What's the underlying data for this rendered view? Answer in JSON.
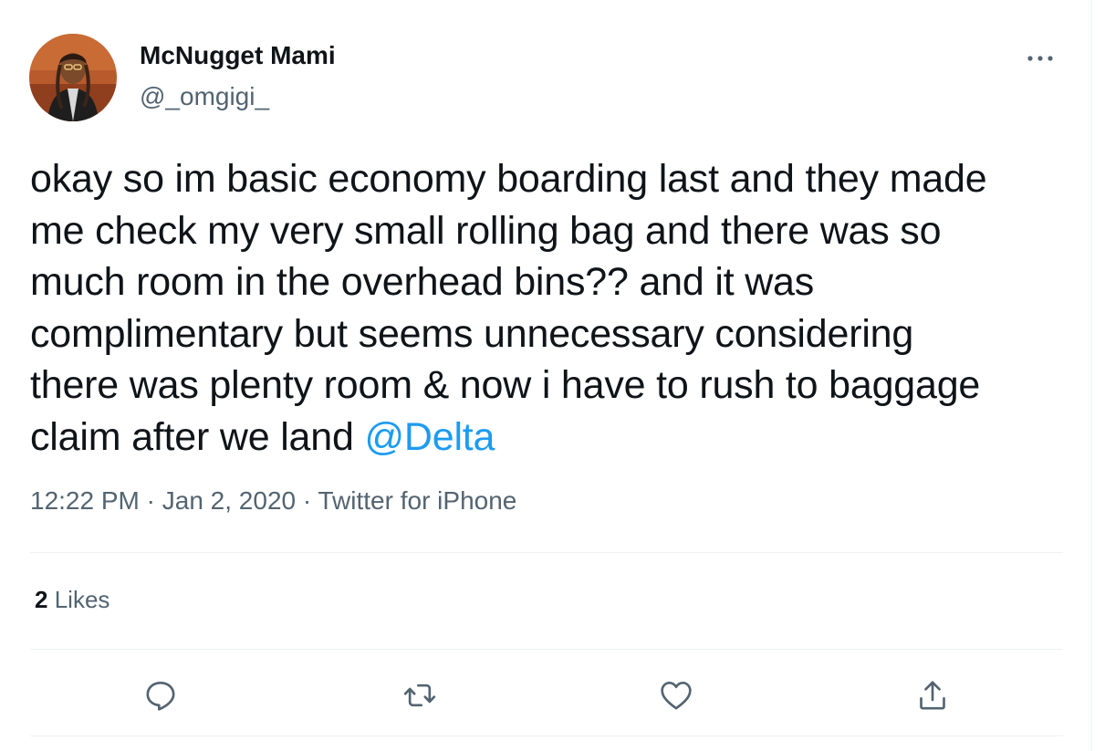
{
  "user": {
    "display_name": "McNugget Mami",
    "handle": "@_omgigi_"
  },
  "tweet": {
    "text_lines": [
      "okay so im basic economy boarding last and they made",
      "me check my very small rolling bag and there was so",
      "much room in the overhead bins?? and it was",
      "complimentary but seems unnecessary considering",
      "there was plenty room & now i have to rush to baggage"
    ],
    "last_line_text": "claim after we land ",
    "mention": "@Delta"
  },
  "meta": {
    "time": "12:22 PM",
    "separator": "·",
    "date": "Jan 2, 2020",
    "source": "Twitter for iPhone"
  },
  "stats": {
    "likes_count": "2",
    "likes_label": "Likes"
  },
  "icons": {
    "more": "more-horizontal-icon",
    "reply": "reply-icon",
    "retweet": "retweet-icon",
    "like": "heart-icon",
    "share": "share-icon"
  },
  "colors": {
    "text": "#0f1419",
    "secondary": "#536471",
    "link": "#1d9bf0",
    "divider": "#eff3f4"
  }
}
